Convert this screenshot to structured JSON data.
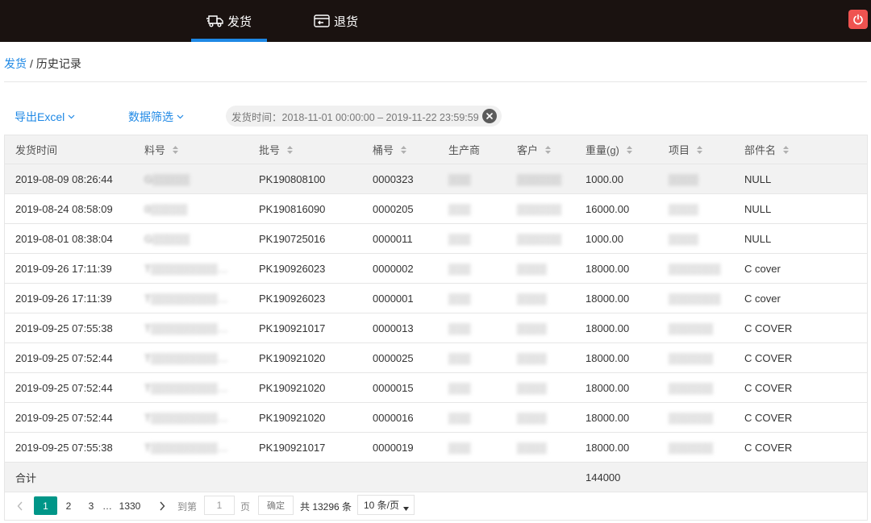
{
  "nav": {
    "tabs": [
      {
        "label": "发货",
        "icon": "truck-icon",
        "active": true
      },
      {
        "label": "退货",
        "icon": "return-box-icon",
        "active": false
      }
    ],
    "power_icon": "power-icon",
    "accent": "#1e88e5",
    "power_color": "#ef5350"
  },
  "breadcrumb": {
    "link": "发货",
    "separator": "/",
    "current": "历史记录"
  },
  "toolbar": {
    "export_label": "导出Excel",
    "filter_label": "数据筛选",
    "filter_tag": "发货时间：2018-11-01 00:00:00 – 2019-11-22 23:59:59"
  },
  "table": {
    "columns": [
      "发货时间",
      "料号",
      "批号",
      "桶号",
      "生产商",
      "客户",
      "重量(g)",
      "项目",
      "部件名"
    ],
    "sortable": [
      false,
      true,
      true,
      true,
      false,
      true,
      true,
      true,
      true
    ],
    "rows": [
      [
        "2019-08-09 08:26:44",
        "G▒▒▒▒▒",
        "PK190808100",
        "0000323",
        "▒▒▒",
        "▒▒▒▒▒▒",
        "1000.00",
        "▒▒▒▒",
        "NULL"
      ],
      [
        "2019-08-24 08:58:09",
        "0▒▒▒▒▒",
        "PK190816090",
        "0000205",
        "▒▒▒",
        "▒▒▒▒▒▒",
        "16000.00",
        "▒▒▒▒",
        "NULL"
      ],
      [
        "2019-08-01 08:38:04",
        "G▒▒▒▒▒",
        "PK190725016",
        "0000011",
        "▒▒▒",
        "▒▒▒▒▒▒",
        "1000.00",
        "▒▒▒▒",
        "NULL"
      ],
      [
        "2019-09-26 17:11:39",
        "T▒▒▒▒▒▒▒▒▒…",
        "PK190926023",
        "0000002",
        "▒▒▒",
        "▒▒▒▒",
        "18000.00",
        "▒▒▒▒▒▒▒",
        "C cover"
      ],
      [
        "2019-09-26 17:11:39",
        "T▒▒▒▒▒▒▒▒▒…",
        "PK190926023",
        "0000001",
        "▒▒▒",
        "▒▒▒▒",
        "18000.00",
        "▒▒▒▒▒▒▒",
        "C cover"
      ],
      [
        "2019-09-25 07:55:38",
        "T▒▒▒▒▒▒▒▒▒…",
        "PK190921017",
        "0000013",
        "▒▒▒",
        "▒▒▒▒",
        "18000.00",
        "▒▒▒▒▒▒",
        "C COVER"
      ],
      [
        "2019-09-25 07:52:44",
        "T▒▒▒▒▒▒▒▒▒…",
        "PK190921020",
        "0000025",
        "▒▒▒",
        "▒▒▒▒",
        "18000.00",
        "▒▒▒▒▒▒",
        "C COVER"
      ],
      [
        "2019-09-25 07:52:44",
        "T▒▒▒▒▒▒▒▒▒…",
        "PK190921020",
        "0000015",
        "▒▒▒",
        "▒▒▒▒",
        "18000.00",
        "▒▒▒▒▒▒",
        "C COVER"
      ],
      [
        "2019-09-25 07:52:44",
        "T▒▒▒▒▒▒▒▒▒…",
        "PK190921020",
        "0000016",
        "▒▒▒",
        "▒▒▒▒",
        "18000.00",
        "▒▒▒▒▒▒",
        "C COVER"
      ],
      [
        "2019-09-25 07:55:38",
        "T▒▒▒▒▒▒▒▒▒…",
        "PK190921017",
        "0000019",
        "▒▒▒",
        "▒▒▒▒",
        "18000.00",
        "▒▒▒▒▒▒",
        "C COVER"
      ]
    ],
    "blurred_columns": [
      1,
      4,
      5,
      7
    ],
    "total_label": "合计",
    "total_weight": "144000"
  },
  "pagination": {
    "current": "1",
    "pages": [
      "2",
      "3"
    ],
    "ellipsis": "…",
    "last": "1330",
    "goto_label": "到第",
    "goto_value": "1",
    "page_unit": "页",
    "confirm_label": "确定",
    "total_text": "共 13296 条",
    "page_size": "10 条/页",
    "accent": "#009688"
  }
}
